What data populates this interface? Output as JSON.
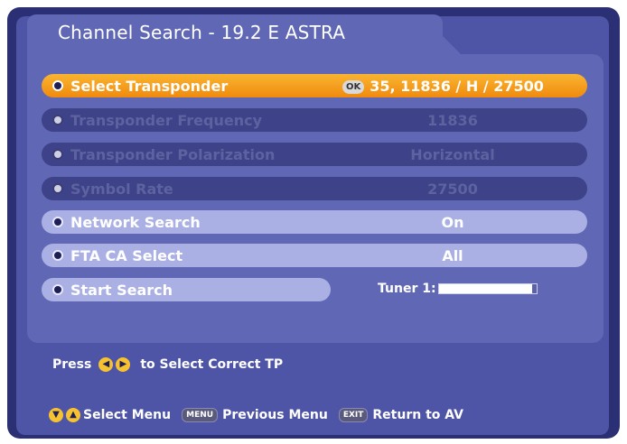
{
  "title": "Channel Search - 19.2 E ASTRA",
  "rows": [
    {
      "label": "Select Transponder",
      "value": "35, 11836 / H / 27500",
      "ok_badge": "OK",
      "state": "selected"
    },
    {
      "label": "Transponder Frequency",
      "value": "11836",
      "state": "disabled"
    },
    {
      "label": "Transponder Polarization",
      "value": "Horizontal",
      "state": "disabled"
    },
    {
      "label": "Symbol Rate",
      "value": "27500",
      "state": "disabled"
    },
    {
      "label": "Network Search",
      "value": "On",
      "state": "normal"
    },
    {
      "label": "FTA CA Select",
      "value": "All",
      "state": "normal"
    },
    {
      "label": "Start Search",
      "state": "normal"
    }
  ],
  "tuner": {
    "label": "Tuner 1:",
    "level_fraction": 0.95
  },
  "hint": {
    "press": "Press",
    "text": "to Select Correct TP",
    "key_left": "◀",
    "key_right": "▶"
  },
  "footer": {
    "updown_key_a": "▼",
    "updown_key_b": "▲",
    "select_menu": "Select Menu",
    "menu_key": "MENU",
    "previous_menu": "Previous Menu",
    "exit_key": "EXIT",
    "return_to_av": "Return to AV"
  },
  "colors": {
    "selected": "#f5a623",
    "background": "#4e54a6",
    "row_normal": "#aab0e3",
    "row_disabled": "#3e4288"
  }
}
